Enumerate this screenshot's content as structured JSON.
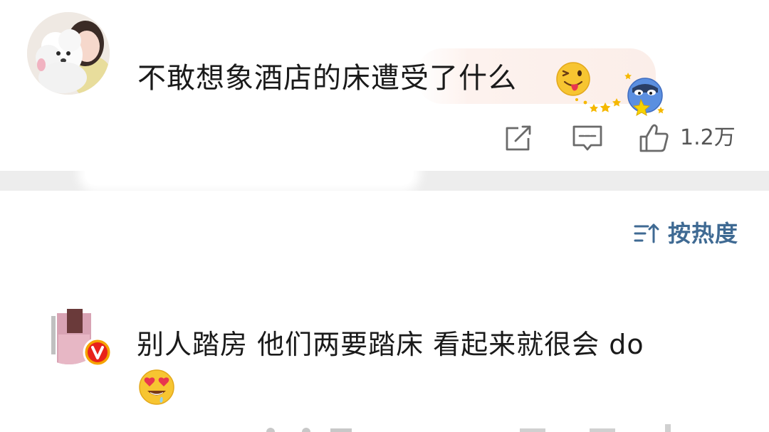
{
  "post": {
    "text": "不敢想象酒店的床遭受了什么",
    "emoji": "winking-tongue-face",
    "actions": {
      "share_icon": "share-edit-icon",
      "comment_icon": "comment-bubble-icon",
      "like_icon": "thumbs-up-icon",
      "like_count": "1.2万"
    }
  },
  "sort": {
    "icon": "sort-lines-arrow-icon",
    "label": "按热度",
    "color": "#3f6a93"
  },
  "comment": {
    "text": "别人踏房 他们两要踏床 看起来就很会 do",
    "emoji": "heart-eyes-drooling-face",
    "badge": "verified-v-badge",
    "badge_color": "#f5a300"
  }
}
